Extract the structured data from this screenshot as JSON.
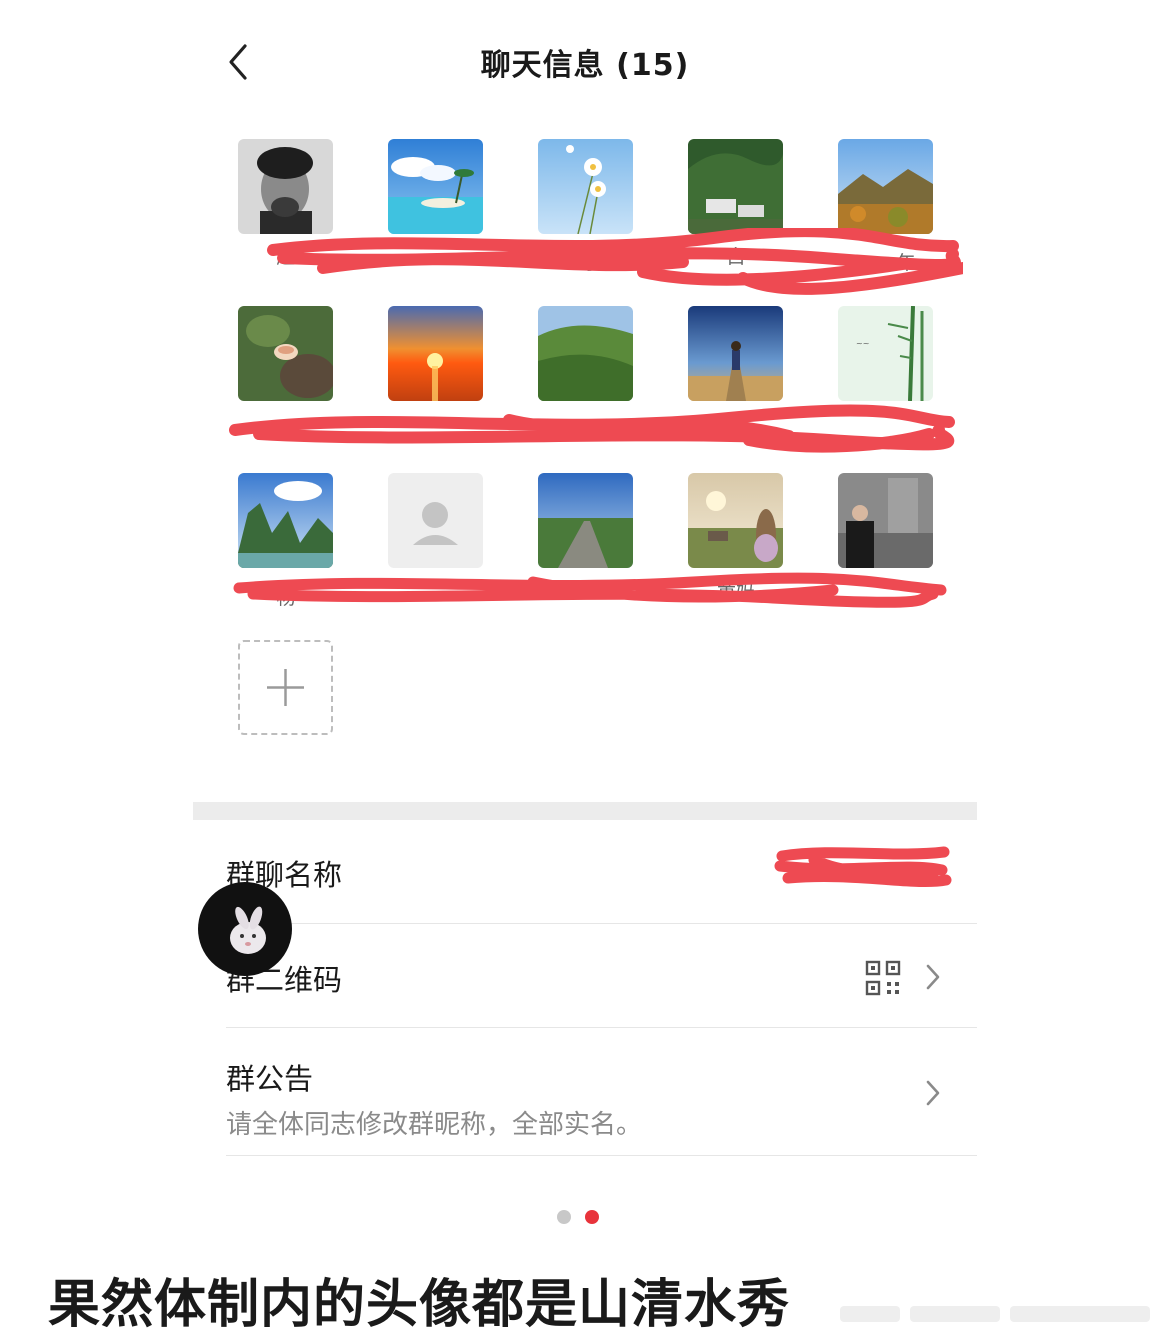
{
  "header": {
    "title": "聊天信息 (15)"
  },
  "members": [
    {
      "name": "赵"
    },
    {
      "name": ""
    },
    {
      "name": "时"
    },
    {
      "name": "白"
    },
    {
      "name": "年"
    },
    {
      "name": ""
    },
    {
      "name": ""
    },
    {
      "name": ""
    },
    {
      "name": ""
    },
    {
      "name": ""
    },
    {
      "name": "杨"
    },
    {
      "name": ""
    },
    {
      "name": ""
    },
    {
      "name": "黄妈"
    },
    {
      "name": ""
    }
  ],
  "settings": {
    "group_name_label": "群聊名称",
    "qr_label": "群二维码",
    "notice_label": "群公告",
    "notice_text": "请全体同志修改群昵称，全部实名。"
  },
  "pager": {
    "total": 2,
    "active": 2,
    "active_color": "#e8333b",
    "inactive_color": "#c8c8c8"
  },
  "caption": "果然体制内的头像都是山清水秀",
  "colors": {
    "redaction": "#ee4a52",
    "divider": "#ececec"
  }
}
